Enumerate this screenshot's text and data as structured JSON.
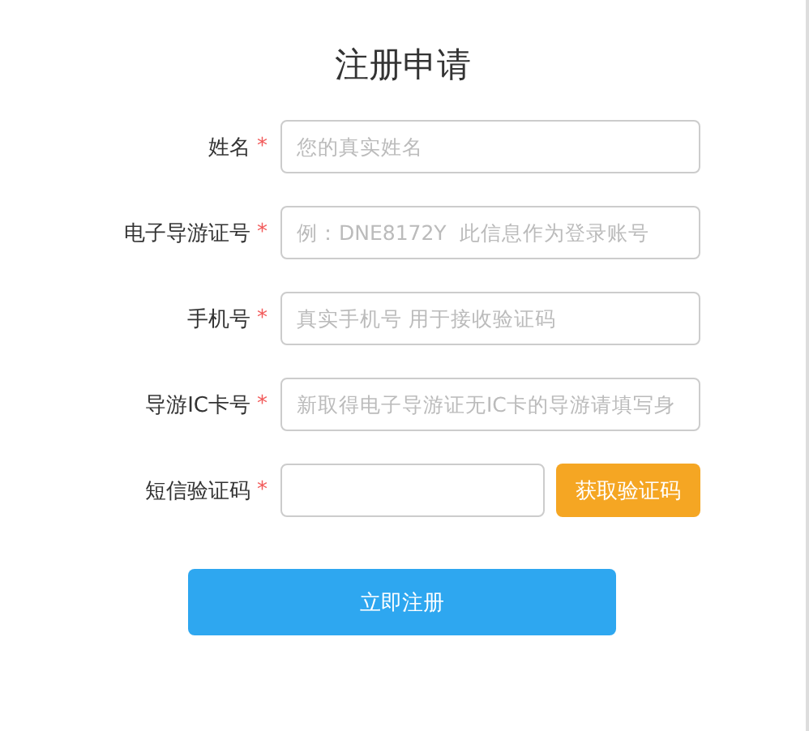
{
  "title": "注册申请",
  "fields": [
    {
      "label": "姓名",
      "required_mark": "*",
      "placeholder": "您的真实姓名",
      "kind": "text"
    },
    {
      "label": "电子导游证号",
      "required_mark": "*",
      "placeholder": "例：DNE8172Y  此信息作为登录账号",
      "kind": "text"
    },
    {
      "label": "手机号",
      "required_mark": "*",
      "placeholder": "真实手机号 用于接收验证码",
      "kind": "text"
    },
    {
      "label": "导游IC卡号",
      "required_mark": "*",
      "placeholder": "新取得电子导游证无IC卡的导游请填写身",
      "kind": "text"
    },
    {
      "label": "短信验证码",
      "required_mark": "*",
      "kind": "code",
      "button": "获取验证码"
    }
  ],
  "submit": "立即注册"
}
